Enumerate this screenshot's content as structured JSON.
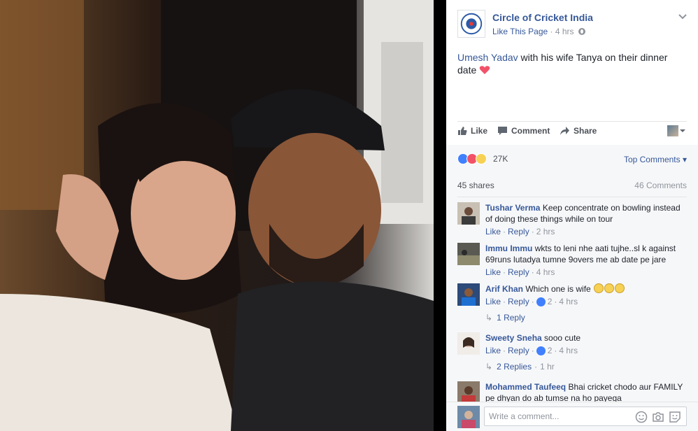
{
  "post": {
    "page_name": "Circle of Cricket India",
    "like_page": "Like This Page",
    "dot": "·",
    "time": "4 hrs",
    "text_tag": "Umesh Yadav",
    "text_rest": " with his wife Tanya on their dinner date",
    "actions": {
      "like": "Like",
      "comment": "Comment",
      "share": "Share"
    },
    "reaction_count": "27K",
    "top_comments": "Top Comments",
    "shares": "45 shares",
    "comments_total": "46 Comments"
  },
  "comments": [
    {
      "author": "Tushar Verma",
      "text": "Keep concentrate on bowling instead of doing these things while on tour",
      "like": "Like",
      "reply": "Reply",
      "time": "2 hrs",
      "likes": ""
    },
    {
      "author": "Immu Immu",
      "text": "wkts to leni nhe aati tujhe..sl k against 69runs lutadya tumne 9overs me ab date pe jare",
      "like": "Like",
      "reply": "Reply",
      "time": "4 hrs",
      "likes": ""
    },
    {
      "author": "Arif Khan",
      "text": "Which one is wife",
      "like": "Like",
      "reply": "Reply",
      "time": "4 hrs",
      "likes": "2",
      "replies": "1 Reply"
    },
    {
      "author": "Sweety Sneha",
      "text": "sooo cute",
      "like": "Like",
      "reply": "Reply",
      "time": "4 hrs",
      "likes": "2",
      "replies": "2 Replies",
      "replies_time": "1 hr"
    },
    {
      "author": "Mohammed Taufeeq",
      "text": "Bhai cricket chodo aur FAMILY pe dhyan do ab tumse na ho payega"
    }
  ],
  "composer": {
    "placeholder": "Write a comment..."
  },
  "colors": {
    "link": "#365899",
    "meta": "#90949c",
    "background": "#f6f7f9",
    "like_blue": "#4080ff",
    "love_red": "#f25268",
    "heart": "#f25268"
  },
  "icons": [
    "globe-icon",
    "chevron-down-icon",
    "thumbs-up-icon",
    "comment-icon",
    "share-icon",
    "emoji-icon",
    "camera-icon",
    "sticker-icon"
  ]
}
